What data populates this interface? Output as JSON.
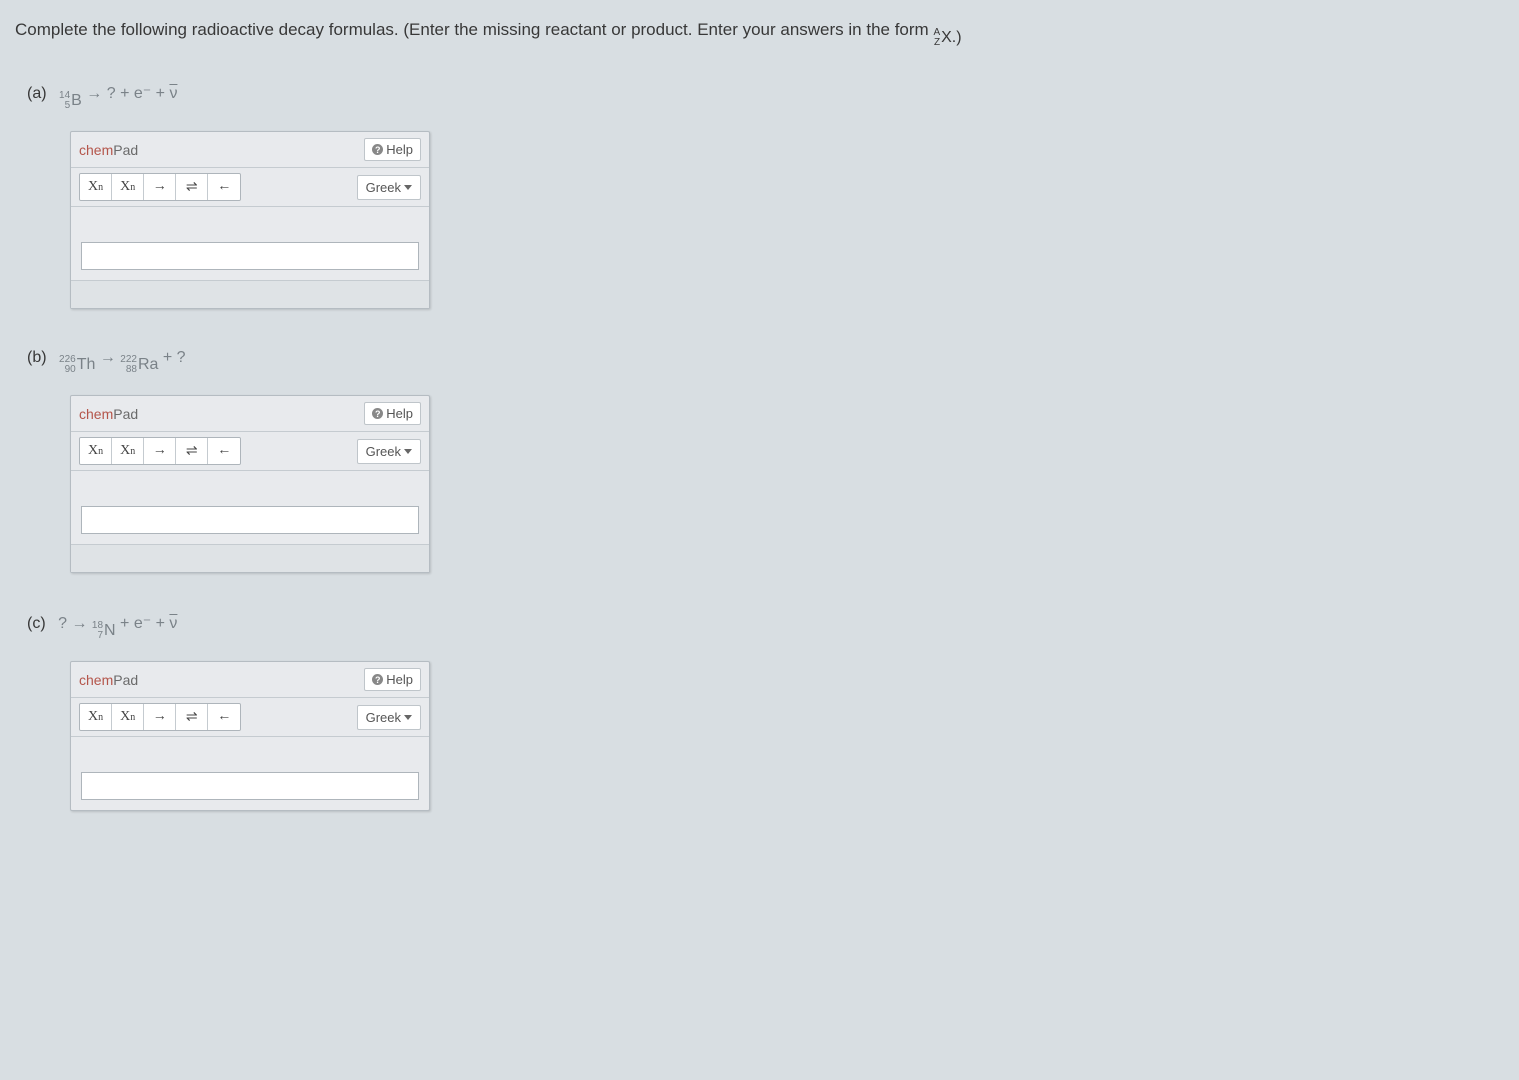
{
  "instruction": {
    "text_before": "Complete the following radioactive decay formulas. (Enter the missing reactant or product. Enter your answers in the form ",
    "notation_A": "A",
    "notation_Z": "Z",
    "notation_X": "X.)",
    "text_after": ""
  },
  "problems": [
    {
      "label": "(a)",
      "equation": {
        "lhs": {
          "A": "14",
          "Z": "5",
          "sym": "B"
        },
        "arrow": "→",
        "rhs_text": "? + e⁻ + ",
        "rhs_nu": "ν"
      }
    },
    {
      "label": "(b)",
      "equation": {
        "lhs": {
          "A": "226",
          "Z": "90",
          "sym": "Th"
        },
        "arrow": "→",
        "mid": {
          "A": "222",
          "Z": "88",
          "sym": "Ra"
        },
        "rhs_text": " + ?"
      }
    },
    {
      "label": "(c)",
      "equation": {
        "lhs_text": "? ",
        "arrow": "→ ",
        "mid": {
          "A": "18",
          "Z": "7",
          "sym": "N"
        },
        "rhs_text": " + e⁻ + ",
        "rhs_nu": "ν"
      }
    }
  ],
  "chempad": {
    "title_prefix": "chem",
    "title_suffix": "Pad",
    "help": "Help",
    "tools": {
      "subscript": "X",
      "subscript_sub": "n",
      "superscript": "X",
      "superscript_sup": "n",
      "arrow_right": "→",
      "arrow_equil": "⇌",
      "arrow_left": "←"
    },
    "greek": "Greek"
  }
}
